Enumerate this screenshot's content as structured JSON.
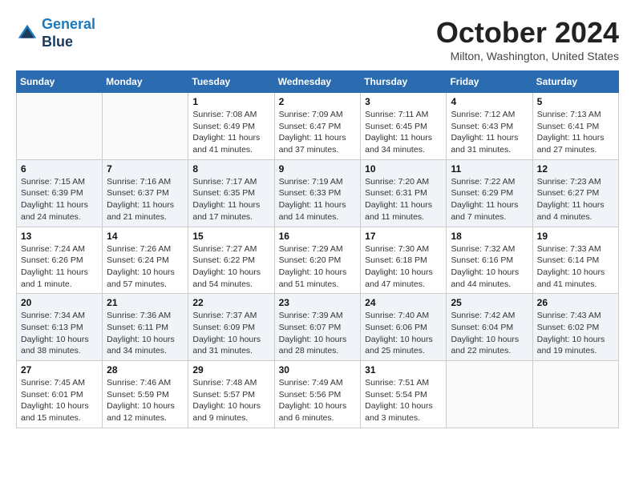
{
  "logo": {
    "line1": "General",
    "line2": "Blue"
  },
  "title": "October 2024",
  "location": "Milton, Washington, United States",
  "weekdays": [
    "Sunday",
    "Monday",
    "Tuesday",
    "Wednesday",
    "Thursday",
    "Friday",
    "Saturday"
  ],
  "weeks": [
    [
      {
        "day": "",
        "sunrise": "",
        "sunset": "",
        "daylight": ""
      },
      {
        "day": "",
        "sunrise": "",
        "sunset": "",
        "daylight": ""
      },
      {
        "day": "1",
        "sunrise": "Sunrise: 7:08 AM",
        "sunset": "Sunset: 6:49 PM",
        "daylight": "Daylight: 11 hours and 41 minutes."
      },
      {
        "day": "2",
        "sunrise": "Sunrise: 7:09 AM",
        "sunset": "Sunset: 6:47 PM",
        "daylight": "Daylight: 11 hours and 37 minutes."
      },
      {
        "day": "3",
        "sunrise": "Sunrise: 7:11 AM",
        "sunset": "Sunset: 6:45 PM",
        "daylight": "Daylight: 11 hours and 34 minutes."
      },
      {
        "day": "4",
        "sunrise": "Sunrise: 7:12 AM",
        "sunset": "Sunset: 6:43 PM",
        "daylight": "Daylight: 11 hours and 31 minutes."
      },
      {
        "day": "5",
        "sunrise": "Sunrise: 7:13 AM",
        "sunset": "Sunset: 6:41 PM",
        "daylight": "Daylight: 11 hours and 27 minutes."
      }
    ],
    [
      {
        "day": "6",
        "sunrise": "Sunrise: 7:15 AM",
        "sunset": "Sunset: 6:39 PM",
        "daylight": "Daylight: 11 hours and 24 minutes."
      },
      {
        "day": "7",
        "sunrise": "Sunrise: 7:16 AM",
        "sunset": "Sunset: 6:37 PM",
        "daylight": "Daylight: 11 hours and 21 minutes."
      },
      {
        "day": "8",
        "sunrise": "Sunrise: 7:17 AM",
        "sunset": "Sunset: 6:35 PM",
        "daylight": "Daylight: 11 hours and 17 minutes."
      },
      {
        "day": "9",
        "sunrise": "Sunrise: 7:19 AM",
        "sunset": "Sunset: 6:33 PM",
        "daylight": "Daylight: 11 hours and 14 minutes."
      },
      {
        "day": "10",
        "sunrise": "Sunrise: 7:20 AM",
        "sunset": "Sunset: 6:31 PM",
        "daylight": "Daylight: 11 hours and 11 minutes."
      },
      {
        "day": "11",
        "sunrise": "Sunrise: 7:22 AM",
        "sunset": "Sunset: 6:29 PM",
        "daylight": "Daylight: 11 hours and 7 minutes."
      },
      {
        "day": "12",
        "sunrise": "Sunrise: 7:23 AM",
        "sunset": "Sunset: 6:27 PM",
        "daylight": "Daylight: 11 hours and 4 minutes."
      }
    ],
    [
      {
        "day": "13",
        "sunrise": "Sunrise: 7:24 AM",
        "sunset": "Sunset: 6:26 PM",
        "daylight": "Daylight: 11 hours and 1 minute."
      },
      {
        "day": "14",
        "sunrise": "Sunrise: 7:26 AM",
        "sunset": "Sunset: 6:24 PM",
        "daylight": "Daylight: 10 hours and 57 minutes."
      },
      {
        "day": "15",
        "sunrise": "Sunrise: 7:27 AM",
        "sunset": "Sunset: 6:22 PM",
        "daylight": "Daylight: 10 hours and 54 minutes."
      },
      {
        "day": "16",
        "sunrise": "Sunrise: 7:29 AM",
        "sunset": "Sunset: 6:20 PM",
        "daylight": "Daylight: 10 hours and 51 minutes."
      },
      {
        "day": "17",
        "sunrise": "Sunrise: 7:30 AM",
        "sunset": "Sunset: 6:18 PM",
        "daylight": "Daylight: 10 hours and 47 minutes."
      },
      {
        "day": "18",
        "sunrise": "Sunrise: 7:32 AM",
        "sunset": "Sunset: 6:16 PM",
        "daylight": "Daylight: 10 hours and 44 minutes."
      },
      {
        "day": "19",
        "sunrise": "Sunrise: 7:33 AM",
        "sunset": "Sunset: 6:14 PM",
        "daylight": "Daylight: 10 hours and 41 minutes."
      }
    ],
    [
      {
        "day": "20",
        "sunrise": "Sunrise: 7:34 AM",
        "sunset": "Sunset: 6:13 PM",
        "daylight": "Daylight: 10 hours and 38 minutes."
      },
      {
        "day": "21",
        "sunrise": "Sunrise: 7:36 AM",
        "sunset": "Sunset: 6:11 PM",
        "daylight": "Daylight: 10 hours and 34 minutes."
      },
      {
        "day": "22",
        "sunrise": "Sunrise: 7:37 AM",
        "sunset": "Sunset: 6:09 PM",
        "daylight": "Daylight: 10 hours and 31 minutes."
      },
      {
        "day": "23",
        "sunrise": "Sunrise: 7:39 AM",
        "sunset": "Sunset: 6:07 PM",
        "daylight": "Daylight: 10 hours and 28 minutes."
      },
      {
        "day": "24",
        "sunrise": "Sunrise: 7:40 AM",
        "sunset": "Sunset: 6:06 PM",
        "daylight": "Daylight: 10 hours and 25 minutes."
      },
      {
        "day": "25",
        "sunrise": "Sunrise: 7:42 AM",
        "sunset": "Sunset: 6:04 PM",
        "daylight": "Daylight: 10 hours and 22 minutes."
      },
      {
        "day": "26",
        "sunrise": "Sunrise: 7:43 AM",
        "sunset": "Sunset: 6:02 PM",
        "daylight": "Daylight: 10 hours and 19 minutes."
      }
    ],
    [
      {
        "day": "27",
        "sunrise": "Sunrise: 7:45 AM",
        "sunset": "Sunset: 6:01 PM",
        "daylight": "Daylight: 10 hours and 15 minutes."
      },
      {
        "day": "28",
        "sunrise": "Sunrise: 7:46 AM",
        "sunset": "Sunset: 5:59 PM",
        "daylight": "Daylight: 10 hours and 12 minutes."
      },
      {
        "day": "29",
        "sunrise": "Sunrise: 7:48 AM",
        "sunset": "Sunset: 5:57 PM",
        "daylight": "Daylight: 10 hours and 9 minutes."
      },
      {
        "day": "30",
        "sunrise": "Sunrise: 7:49 AM",
        "sunset": "Sunset: 5:56 PM",
        "daylight": "Daylight: 10 hours and 6 minutes."
      },
      {
        "day": "31",
        "sunrise": "Sunrise: 7:51 AM",
        "sunset": "Sunset: 5:54 PM",
        "daylight": "Daylight: 10 hours and 3 minutes."
      },
      {
        "day": "",
        "sunrise": "",
        "sunset": "",
        "daylight": ""
      },
      {
        "day": "",
        "sunrise": "",
        "sunset": "",
        "daylight": ""
      }
    ]
  ]
}
